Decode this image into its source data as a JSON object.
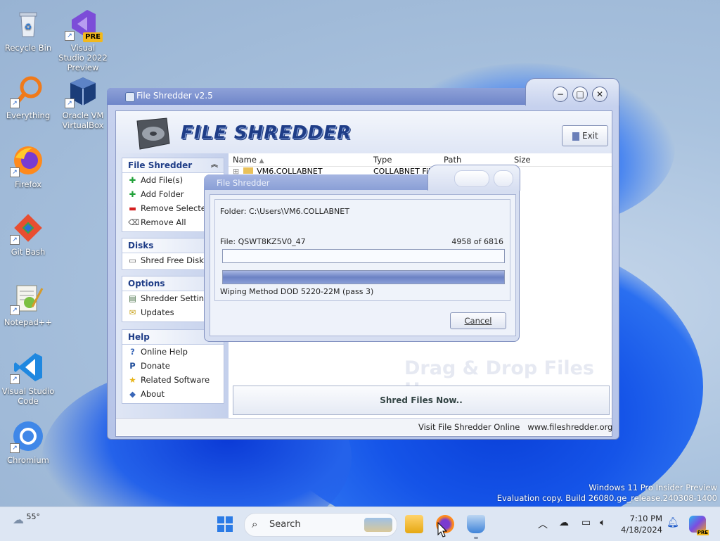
{
  "desktop": {
    "icons": [
      {
        "label": "Recycle Bin"
      },
      {
        "label": "Visual Studio 2022 Preview",
        "badge": "PRE"
      },
      {
        "label": "Everything"
      },
      {
        "label": "Oracle VM VirtualBox"
      },
      {
        "label": "Firefox"
      },
      {
        "label": "Git Bash"
      },
      {
        "label": "Notepad++"
      },
      {
        "label": "Visual Studio Code"
      },
      {
        "label": "Chromium"
      }
    ],
    "watermark_line1": "Windows 11 Pro Insider Preview",
    "watermark_line2": "Evaluation copy. Build 26080.ge_release.240308-1400"
  },
  "window": {
    "title": "File Shredder v2.5",
    "logo_text": "FILE SHREDDER",
    "exit_label": "Exit",
    "minimize": "−",
    "maximize": "□",
    "close": "✕"
  },
  "sidebar": {
    "file_shredder": {
      "heading": "File Shredder",
      "items": [
        "Add File(s)",
        "Add Folder",
        "Remove Selected",
        "Remove All"
      ]
    },
    "disks": {
      "heading": "Disks",
      "items": [
        "Shred Free Disk Space"
      ]
    },
    "options": {
      "heading": "Options",
      "items": [
        "Shredder Settings",
        "Updates"
      ]
    },
    "help": {
      "heading": "Help",
      "items": [
        "Online Help",
        "Donate",
        "Related Software",
        "About"
      ]
    }
  },
  "file_list": {
    "columns": [
      "Name",
      "Type",
      "Path",
      "Size"
    ],
    "rows": [
      {
        "name": "VM6.COLLABNET",
        "type": "COLLABNET File"
      }
    ],
    "drop_hint": "Drag & Drop Files Here"
  },
  "shred_button": "Shred Files Now..",
  "status": {
    "visit": "Visit File Shredder Online",
    "url": "www.fileshredder.org"
  },
  "dialog": {
    "title": "File Shredder",
    "folder": "Folder: C:\\Users\\VM6.COLLABNET",
    "file": "File: QSWT8KZ5V0_47",
    "count": "4958  of  6816",
    "file_progress": 0,
    "total_progress": 1.0,
    "method": "Wiping Method DOD 5220-22M  (pass 3)",
    "cancel": "Cancel"
  },
  "taskbar": {
    "weather": "55°",
    "search_placeholder": "Search",
    "time": "7:10 PM",
    "date": "4/18/2024",
    "badge": "PRE"
  },
  "colors": {
    "accent": "#1f3d87",
    "title_bar": "#7f94d0",
    "progress": "#6c82c4"
  }
}
